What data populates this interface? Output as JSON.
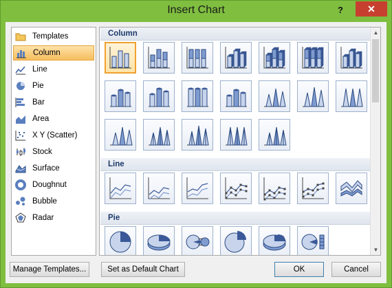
{
  "window": {
    "title": "Insert Chart",
    "help_label": "?",
    "close_label": "✕"
  },
  "chart_types": [
    {
      "label": "Templates",
      "icon": "folder-icon",
      "selected": false
    },
    {
      "label": "Column",
      "icon": "column-chart-icon",
      "selected": true
    },
    {
      "label": "Line",
      "icon": "line-chart-icon",
      "selected": false
    },
    {
      "label": "Pie",
      "icon": "pie-chart-icon",
      "selected": false
    },
    {
      "label": "Bar",
      "icon": "bar-chart-icon",
      "selected": false
    },
    {
      "label": "Area",
      "icon": "area-chart-icon",
      "selected": false
    },
    {
      "label": "X Y (Scatter)",
      "icon": "scatter-chart-icon",
      "selected": false
    },
    {
      "label": "Stock",
      "icon": "stock-chart-icon",
      "selected": false
    },
    {
      "label": "Surface",
      "icon": "surface-chart-icon",
      "selected": false
    },
    {
      "label": "Doughnut",
      "icon": "doughnut-chart-icon",
      "selected": false
    },
    {
      "label": "Bubble",
      "icon": "bubble-chart-icon",
      "selected": false
    },
    {
      "label": "Radar",
      "icon": "radar-chart-icon",
      "selected": false
    }
  ],
  "gallery": {
    "sections": [
      {
        "title": "Column",
        "subtypes": [
          "clustered-column-icon",
          "stacked-column-icon",
          "100-percent-stacked-column-icon",
          "3d-clustered-column-icon",
          "3d-stacked-column-icon",
          "3d-100-percent-stacked-column-icon",
          "3d-column-icon",
          "clustered-cylinder-icon",
          "stacked-cylinder-icon",
          "100-percent-stacked-cylinder-icon",
          "3d-cylinder-icon",
          "clustered-cone-icon",
          "stacked-cone-icon",
          "100-percent-stacked-cone-icon",
          "3d-cone-icon",
          "clustered-pyramid-icon",
          "stacked-pyramid-icon",
          "100-percent-stacked-pyramid-icon",
          "3d-pyramid-icon"
        ]
      },
      {
        "title": "Line",
        "subtypes": [
          "line-icon",
          "stacked-line-icon",
          "100-percent-stacked-line-icon",
          "line-with-markers-icon",
          "stacked-line-with-markers-icon",
          "100-percent-stacked-line-with-markers-icon",
          "3d-line-icon"
        ]
      },
      {
        "title": "Pie",
        "subtypes": [
          "pie-icon",
          "3d-pie-icon",
          "pie-of-pie-icon",
          "exploded-pie-icon",
          "exploded-3d-pie-icon",
          "bar-of-pie-icon"
        ]
      }
    ],
    "selected_subtype": "clustered-column-icon"
  },
  "scrollbar": {
    "up_arrow": "▲",
    "down_arrow": "▼"
  },
  "buttons": {
    "manage_templates": "Manage Templates...",
    "set_default": "Set as Default Chart",
    "ok": "OK",
    "cancel": "Cancel"
  },
  "colors": {
    "frame": "#7fbe3f",
    "close": "#c7402f",
    "selection": "#f7bd5e",
    "section_header_text": "#1e3a6a"
  }
}
